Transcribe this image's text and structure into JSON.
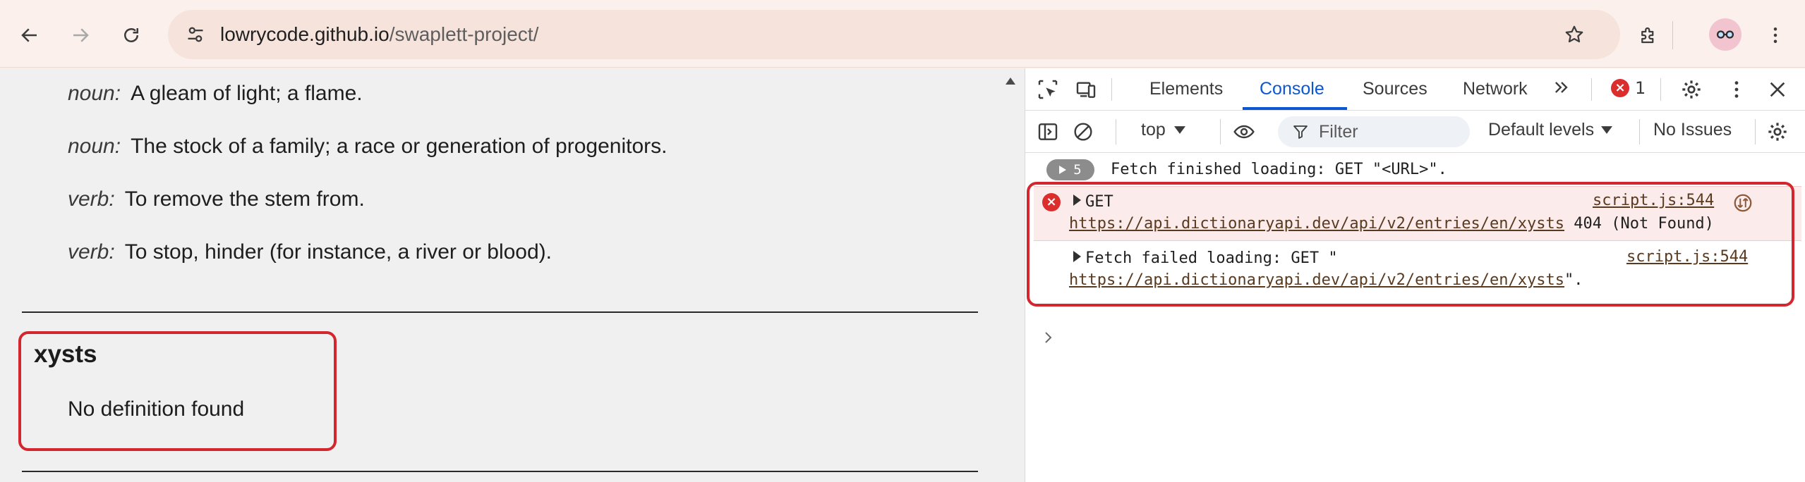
{
  "browser": {
    "url_host": "lowrycode.github.io",
    "url_path": "/swaplett-project/"
  },
  "page": {
    "definitions": [
      {
        "pos": "noun:",
        "text": "A gleam of light; a flame."
      },
      {
        "pos": "noun:",
        "text": "The stock of a family; a race or generation of progenitors."
      },
      {
        "pos": "verb:",
        "text": "To remove the stem from."
      },
      {
        "pos": "verb:",
        "text": "To stop, hinder (for instance, a river or blood)."
      }
    ],
    "word": "xysts",
    "no_definition": "No definition found"
  },
  "devtools": {
    "tabs": [
      "Elements",
      "Console",
      "Sources",
      "Network"
    ],
    "active_tab": "Console",
    "error_count": "1",
    "toolbar": {
      "context": "top",
      "filter_placeholder": "Filter",
      "levels": "Default levels",
      "issues": "No Issues"
    },
    "console": {
      "repeat_count": "5",
      "fetch_finished": "Fetch finished loading: GET \"<URL>\".",
      "error_method": "GET",
      "error_url": "https://api.dictionaryapi.dev/api/v2/entries/en/xysts",
      "error_status": "404 (Not Found)",
      "error_source": "script.js:544",
      "failed_prefix": "Fetch failed loading: GET \"",
      "failed_url": "https://api.dictionaryapi.dev/api/v2/entries/en/xysts",
      "failed_suffix": "\".",
      "failed_source": "script.js:544"
    }
  },
  "colors": {
    "accent": "#0b57d0",
    "error": "#dc2d2d",
    "highlight": "#d3262e",
    "toolbar_bg": "#fbf0ec",
    "page_bg": "#eff0ef"
  }
}
